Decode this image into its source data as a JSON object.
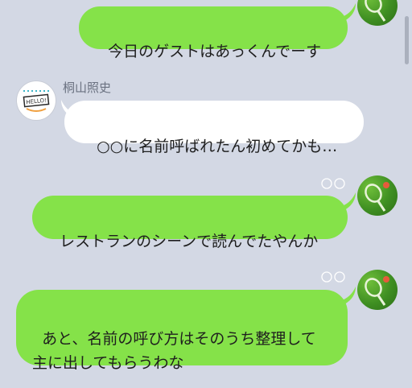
{
  "messages": [
    {
      "id": "m1",
      "sender": "me",
      "text": "今日のゲストはあっくんでーす"
    },
    {
      "id": "m2",
      "sender": "other",
      "sender_name": "桐山照史",
      "text": "○○に名前呼ばれたん初めてかも…"
    },
    {
      "id": "m3",
      "sender": "me",
      "text": "レストランのシーンで読んでたやんか"
    },
    {
      "id": "m4",
      "sender": "me",
      "text": "あと、名前の呼び方はそのうち整理して\n主に出してもらうわな"
    }
  ],
  "avatar_other_text": "HELLO!",
  "colors": {
    "background": "#d3d8e4",
    "my_bubble": "#85e249",
    "other_bubble": "#ffffff"
  }
}
